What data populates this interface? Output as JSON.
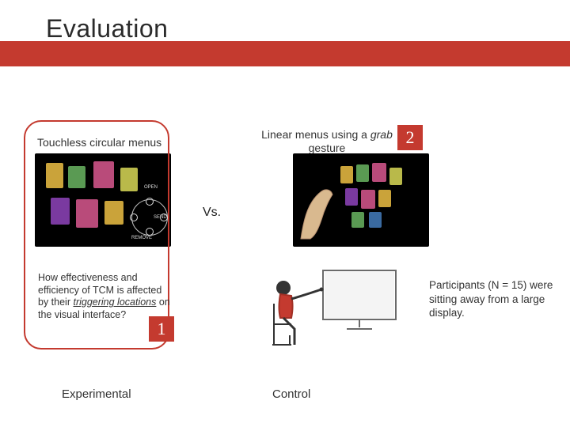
{
  "title": "Evaluation",
  "left_caption": "Touchless circular menus",
  "right_caption_pre": "Linear menus using a ",
  "right_caption_em": "grab",
  "right_caption_post": " gesture",
  "vs": "Vs.",
  "badge_1": "1",
  "badge_2": "2",
  "question_pre": "How effectiveness and efficiency of TCM is affected by their ",
  "question_em": "triggering locations",
  "question_post": " on the visual interface?",
  "participants": "Participants (N = 15) were sitting away from a large display.",
  "condition_left": "Experimental",
  "condition_right": "Control",
  "circular_menu_labels": {
    "open": "OPEN",
    "send": "SEND",
    "remove": "REMOVE"
  }
}
